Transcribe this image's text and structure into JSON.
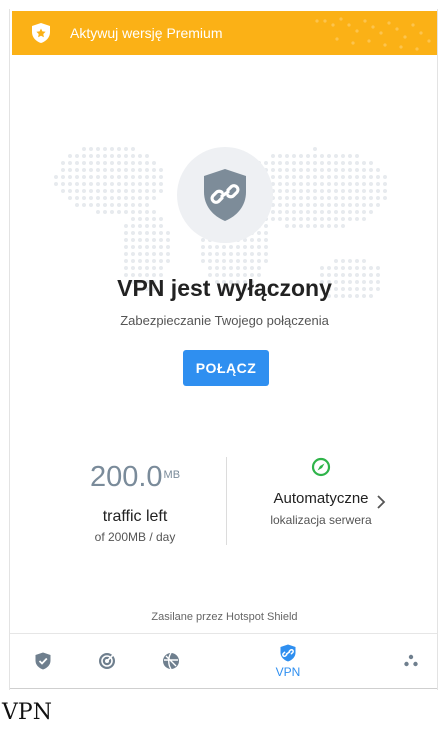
{
  "banner": {
    "text": "Aktywuj wersję Premium"
  },
  "status": {
    "title": "VPN jest wyłączony",
    "subtitle": "Zabezpieczanie Twojego połączenia",
    "connect_label": "POŁĄCZ"
  },
  "traffic": {
    "value": "200.0",
    "unit": "MB",
    "label": "traffic left",
    "sub": "of 200MB / day"
  },
  "location": {
    "label": "Automatyczne",
    "sub": "lokalizacja serwera"
  },
  "footer": {
    "powered_by": "Zasilane przez Hotspot Shield"
  },
  "tabs": [
    {
      "id": "protection",
      "icon": "shield-check-icon",
      "label": ""
    },
    {
      "id": "scanner",
      "icon": "target-icon",
      "label": ""
    },
    {
      "id": "speed",
      "icon": "speed-globe-icon",
      "label": ""
    },
    {
      "id": "vpn",
      "icon": "vpn-shield-icon",
      "label": "VPN",
      "active": true
    },
    {
      "id": "more",
      "icon": "more-dots-icon",
      "label": ""
    }
  ],
  "caption": "VPN",
  "colors": {
    "banner": "#fbb116",
    "accent": "#2f8ff0",
    "shield": "#7d8c99",
    "compass": "#2fb44a",
    "tab_icon": "#6f7f8e"
  }
}
